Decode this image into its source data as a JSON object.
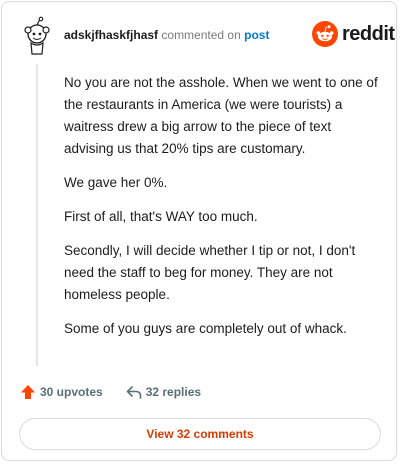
{
  "colors": {
    "accent": "#ff4500",
    "link": "#0079d3",
    "button_text": "#d93a00",
    "muted": "#7c7c7c"
  },
  "header": {
    "username": "adskjfhaskfjhasf",
    "action_text": "commented on",
    "post_link": "post"
  },
  "brand": {
    "icon": "reddit-snoo-icon",
    "wordmark": "reddit"
  },
  "comment": {
    "paragraphs": [
      "No you are not the asshole. When we went to one of the restaurants in America (we were tourists) a waitress drew a big arrow to the piece of text advising us that 20% tips are customary.",
      "We gave her 0%.",
      "First of all, that's WAY too much.",
      "Secondly, I will decide whether I tip or not, I don't need the staff to beg for money. They are not homeless people.",
      "Some of you guys are completely out of whack."
    ]
  },
  "actions": {
    "upvotes_label": "30 upvotes",
    "upvote_icon": "upvote-arrow-icon",
    "replies_label": "32 replies",
    "reply_icon": "reply-arrow-icon"
  },
  "footer": {
    "view_comments_label": "View 32 comments"
  }
}
